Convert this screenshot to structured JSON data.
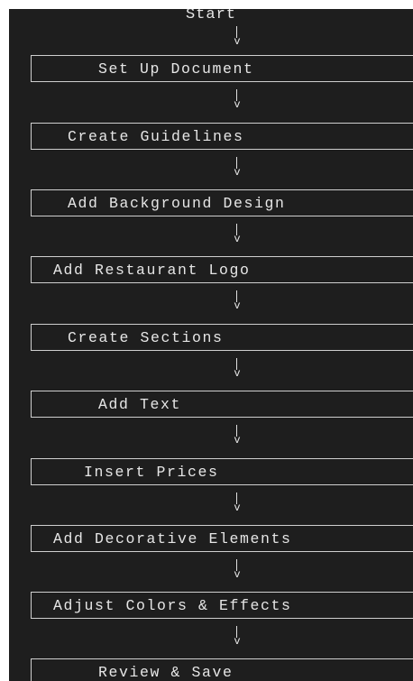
{
  "diagram": {
    "start_label": "Start",
    "arrow_glyph": "v",
    "steps": [
      {
        "label": "Set Up Document"
      },
      {
        "label": "Create Guidelines"
      },
      {
        "label": "Add Background Design"
      },
      {
        "label": "Add Restaurant Logo"
      },
      {
        "label": "Create Sections"
      },
      {
        "label": "Add Text"
      },
      {
        "label": "Insert Prices"
      },
      {
        "label": "Add Decorative Elements"
      },
      {
        "label": "Adjust Colors & Effects"
      },
      {
        "label": "Review & Save"
      }
    ]
  },
  "colors": {
    "background": "#1e1e1e",
    "text": "#e6e6e6",
    "box_border": "#cfcfcf"
  }
}
